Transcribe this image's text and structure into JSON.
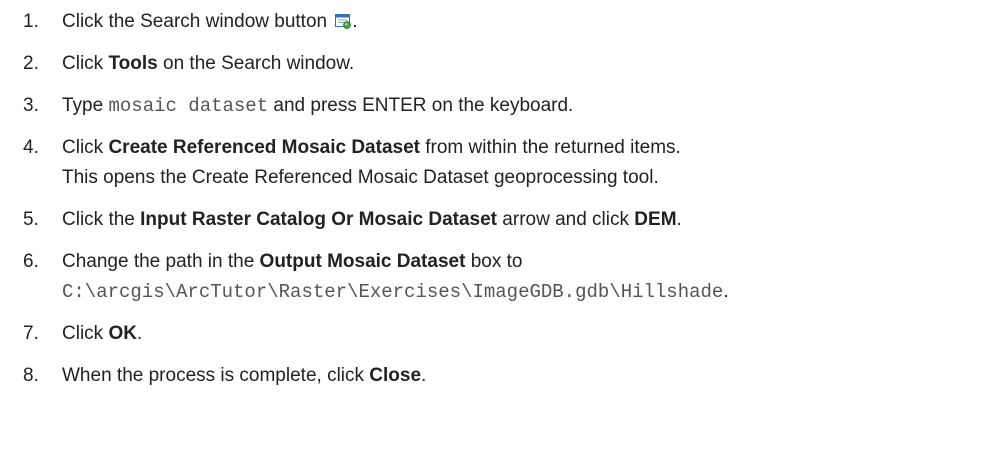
{
  "steps": [
    {
      "num": "1.",
      "pre": "Click the Search window button ",
      "icon": "search-window-icon",
      "post": "."
    },
    {
      "num": "2.",
      "pre": "Click ",
      "bold": "Tools",
      "post": " on the Search window."
    },
    {
      "num": "3.",
      "pre": "Type ",
      "code": "mosaic dataset",
      "post": " and press ENTER on the keyboard."
    },
    {
      "num": "4.",
      "pre": "Click ",
      "bold": "Create Referenced Mosaic Dataset",
      "post": " from within the returned items.",
      "line2": "This opens the Create Referenced Mosaic Dataset geoprocessing tool."
    },
    {
      "num": "5.",
      "pre": "Click the ",
      "bold": "Input Raster Catalog Or Mosaic Dataset",
      "mid": " arrow and click ",
      "bold2": "DEM",
      "post": "."
    },
    {
      "num": "6.",
      "pre": "Change the path in the ",
      "bold": "Output Mosaic Dataset",
      "post": " box to",
      "line2_code": "C:\\arcgis\\ArcTutor\\Raster\\Exercises\\ImageGDB.gdb\\Hillshade",
      "line2_post": "."
    },
    {
      "num": "7.",
      "pre": "Click ",
      "bold": "OK",
      "post": "."
    },
    {
      "num": "8.",
      "pre": "When the process is complete, click ",
      "bold": "Close",
      "post": "."
    }
  ],
  "colors": {
    "text": "#222222",
    "code": "#555555",
    "icon_blue": "#3a6fb5",
    "icon_green": "#3ea33a"
  }
}
